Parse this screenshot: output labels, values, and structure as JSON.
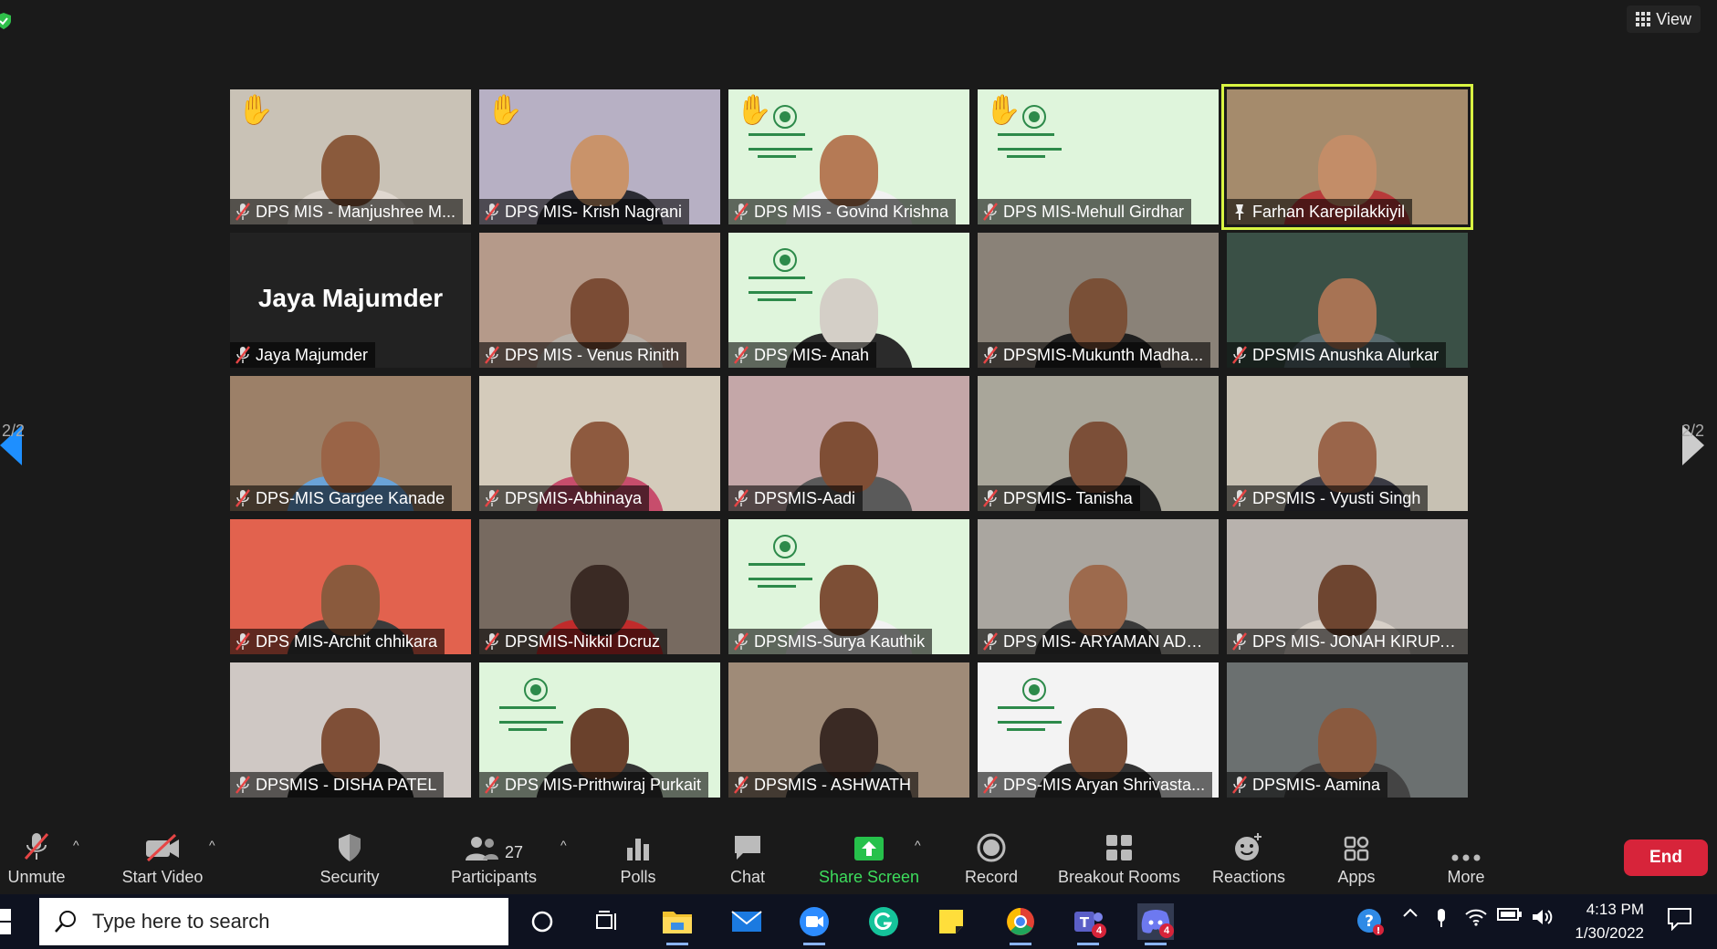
{
  "top": {
    "view_label": "View"
  },
  "pagination": {
    "left": "2/2",
    "right": "2/2"
  },
  "participants": [
    {
      "name": "DPS MIS - Manjushree M...",
      "muted": true,
      "hand": true,
      "bg": "#c9c2b6",
      "skin": "#8a5a3c",
      "shirt": "#e0d8d0"
    },
    {
      "name": "DPS MIS- Krish Nagrani",
      "muted": true,
      "hand": true,
      "bg": "#b7b0c4",
      "skin": "#c9936a",
      "shirt": "#2c2c34"
    },
    {
      "name": "DPS MIS - Govind Krishna",
      "muted": true,
      "hand": true,
      "bg": "#dff5dc",
      "skin": "#b57a55",
      "shirt": "#f2f2f2",
      "banner": true
    },
    {
      "name": "DPS MIS-Mehull Girdhar",
      "muted": true,
      "hand": true,
      "bg": "#dff5dc",
      "skin": "#00000000",
      "shirt": "#00000000",
      "banner": true
    },
    {
      "name": "Farhan Karepilakkiyil",
      "muted": false,
      "pinned": true,
      "active": true,
      "bg": "#a58b6c",
      "skin": "#c38d68",
      "shirt": "#b83a3a"
    },
    {
      "name": "Jaya Majumder",
      "muted": true,
      "noVideo": true,
      "bigname": "Jaya Majumder"
    },
    {
      "name": "DPS MIS - Venus Rinith",
      "muted": true,
      "bg": "#b59a8a",
      "skin": "#7b4c35",
      "shirt": "#b8b0a8"
    },
    {
      "name": "DPS MIS- Anah",
      "muted": true,
      "bg": "#dff5dc",
      "skin": "#d4cfc7",
      "shirt": "#2b2b2b",
      "banner": true
    },
    {
      "name": "DPSMIS-Mukunth Madha...",
      "muted": true,
      "bg": "#8a8278",
      "skin": "#7a5037",
      "shirt": "#1f1f1f"
    },
    {
      "name": "DPSMIS Anushka Alurkar",
      "muted": true,
      "bg": "#3a5046",
      "skin": "#a77354",
      "shirt": "#5a6c70"
    },
    {
      "name": "DPS-MIS Gargee Kanade",
      "muted": true,
      "bg": "#9c8068",
      "skin": "#9a6447",
      "shirt": "#6aa3d8"
    },
    {
      "name": "DPSMIS-Abhinaya",
      "muted": true,
      "bg": "#d4cbbb",
      "skin": "#8e5a3f",
      "shirt": "#c74d6c"
    },
    {
      "name": "DPSMIS-Aadi",
      "muted": true,
      "bg": "#c4a7a8",
      "skin": "#7f4e35",
      "shirt": "#5a5a5a"
    },
    {
      "name": "DPSMIS- Tanisha",
      "muted": true,
      "bg": "#a9a69a",
      "skin": "#7c4f38",
      "shirt": "#232323"
    },
    {
      "name": "DPSMIS - Vyusti Singh",
      "muted": true,
      "bg": "#c7c1b3",
      "skin": "#9a654a",
      "shirt": "#3b3b44"
    },
    {
      "name": "DPS MIS-Archit chhikara",
      "muted": true,
      "bg": "#e2624e",
      "skin": "#8a5a3d",
      "shirt": "#3b3b3b"
    },
    {
      "name": "DPSMIS-Nikkil Dcruz",
      "muted": true,
      "bg": "#776a60",
      "skin": "#3a2a24",
      "shirt": "#c02b2b"
    },
    {
      "name": "DPSMIS-Surya Kauthik",
      "muted": true,
      "bg": "#dff5dc",
      "skin": "#7d4f36",
      "shirt": "#f2f2f2",
      "banner": true
    },
    {
      "name": "DPS MIS- ARYAMAN ADH...",
      "muted": true,
      "bg": "#aaa6a0",
      "skin": "#9d6a4d",
      "shirt": "#3a3a3a"
    },
    {
      "name": "DPS MIS- JONAH KIRUPA...",
      "muted": true,
      "bg": "#b8b2ad",
      "skin": "#6e4530",
      "shirt": "#d8d0c8"
    },
    {
      "name": "DPSMIS - DISHA PATEL",
      "muted": true,
      "bg": "#cfc8c4",
      "skin": "#7f4f37",
      "shirt": "#222"
    },
    {
      "name": "DPS MIS-Prithwiraj Purkait",
      "muted": true,
      "bg": "#dff5dc",
      "skin": "#6a412c",
      "shirt": "#333",
      "banner": true
    },
    {
      "name": "DPSMIS - ASHWATH",
      "muted": true,
      "bg": "#9f8b78",
      "skin": "#3a2a24",
      "shirt": "#333"
    },
    {
      "name": "DPS-MIS Aryan Shrivasta...",
      "muted": true,
      "bg": "#f3f3f3",
      "skin": "#7a4f38",
      "shirt": "#333",
      "banner": true
    },
    {
      "name": "DPSMIS- Aamina",
      "muted": true,
      "bg": "#6b7070",
      "skin": "#8a5a3f",
      "shirt": "#444"
    }
  ],
  "toolbar": {
    "unmute": "Unmute",
    "start_video": "Start Video",
    "security": "Security",
    "participants": "Participants",
    "participant_count": "27",
    "polls": "Polls",
    "chat": "Chat",
    "share_screen": "Share Screen",
    "record": "Record",
    "breakout_rooms": "Breakout Rooms",
    "reactions": "Reactions",
    "apps": "Apps",
    "more": "More",
    "end": "End"
  },
  "taskbar": {
    "search_placeholder": "Type here to search",
    "teams_badge": "4",
    "discord_badge": "4",
    "time": "4:13 PM",
    "date": "1/30/2022"
  },
  "colors": {
    "accent_green": "#3ddc5c",
    "end_red": "#d7243a",
    "active_outline": "#d9f542",
    "arrow_blue": "#1e8fff"
  }
}
